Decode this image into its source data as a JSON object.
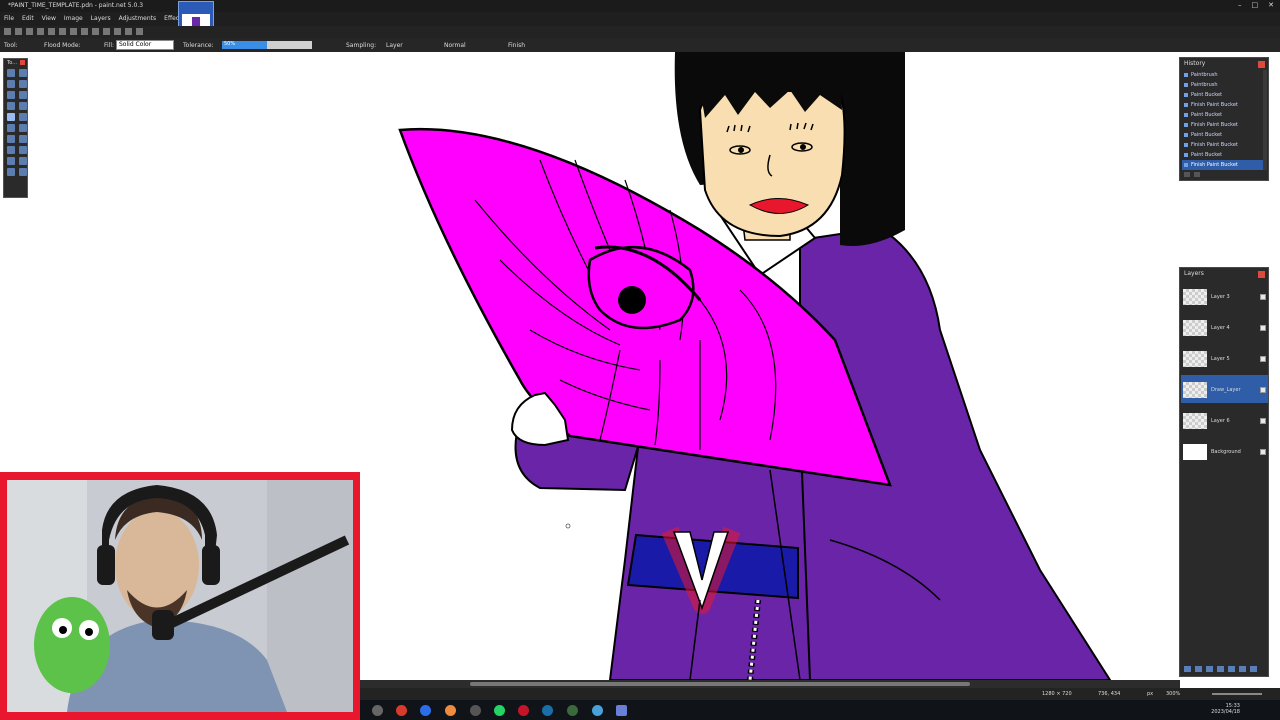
{
  "window": {
    "title": "*PAINT_TIME_TEMPLATE.pdn - paint.net 5.0.3"
  },
  "menu": [
    "File",
    "Edit",
    "View",
    "Image",
    "Layers",
    "Adjustments",
    "Effects"
  ],
  "toolbar": {
    "tool_label": "Tool:",
    "flood_mode_label": "Flood Mode:",
    "fill_label": "Fill:",
    "fill_value": "Solid Color",
    "tolerance_label": "Tolerance:",
    "tolerance_value": "50%",
    "sampling_label": "Sampling:",
    "sampling_value": "Layer",
    "blend_value": "Normal",
    "finish_label": "Finish"
  },
  "tools_panel": {
    "title": "To..."
  },
  "history": {
    "title": "History",
    "items": [
      "Paintbrush",
      "Paintbrush",
      "Paint Bucket",
      "Finish Paint Bucket",
      "Paint Bucket",
      "Finish Paint Bucket",
      "Paint Bucket",
      "Finish Paint Bucket",
      "Paint Bucket",
      "Finish Paint Bucket"
    ],
    "selected_index": 9
  },
  "layers": {
    "title": "Layers",
    "items": [
      "Layer 3",
      "Layer 4",
      "Layer 5",
      "Draw_Layer",
      "Layer 6",
      "Background"
    ],
    "selected_index": 3
  },
  "status": {
    "image_size": "1280 × 720",
    "cursor_pos": "736, 434",
    "units": "px",
    "zoom": "300%"
  },
  "taskbar": {
    "time": "15:33",
    "date": "2023/04/18"
  },
  "colors": {
    "fan": "#ff00ff",
    "robe": "#6a24a8",
    "belt": "#1a1aa8",
    "skin": "#f8deb0",
    "accent": "#e8172d"
  }
}
